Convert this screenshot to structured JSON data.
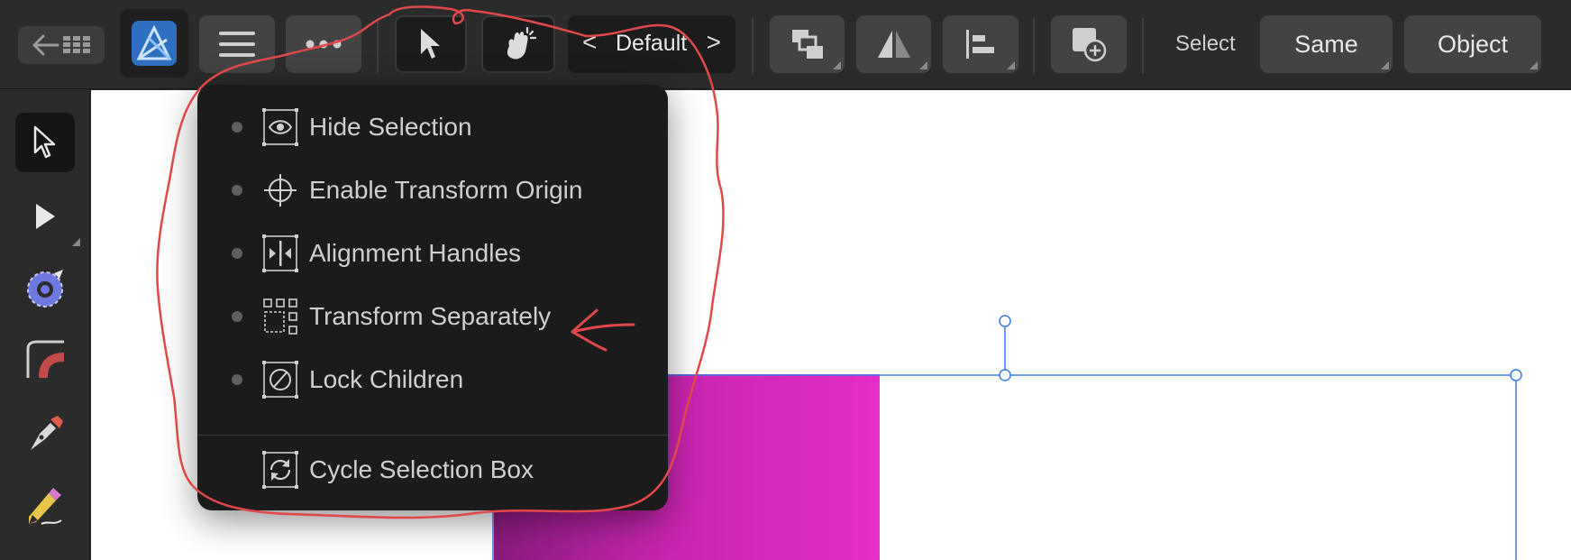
{
  "toolbar": {
    "personas_label": "Default",
    "select_label": "Select",
    "same_label": "Same",
    "object_label": "Object"
  },
  "menu": {
    "items": [
      {
        "label": "Hide Selection"
      },
      {
        "label": "Enable Transform Origin"
      },
      {
        "label": "Alignment Handles"
      },
      {
        "label": "Transform Separately"
      },
      {
        "label": "Lock Children"
      },
      {
        "label": "Cycle Selection Box"
      }
    ]
  },
  "colors": {
    "annotation": "#e0484a",
    "selection": "#3b7be8",
    "magenta_shape": "#e42fc8"
  },
  "icons": [
    "back-arrow-icon",
    "grid-icon",
    "designer-app-icon",
    "hamburger-icon",
    "more-icon",
    "move-tool-icon",
    "touch-icon",
    "arrange-icon",
    "flip-icon",
    "align-icon",
    "insert-icon",
    "eye-icon",
    "crosshair-icon",
    "alignment-handles-icon",
    "transform-separately-icon",
    "lock-icon",
    "cycle-icon",
    "node-tool-icon",
    "gradient-tool-icon",
    "corner-tool-icon",
    "pen-icon",
    "pencil-icon"
  ]
}
